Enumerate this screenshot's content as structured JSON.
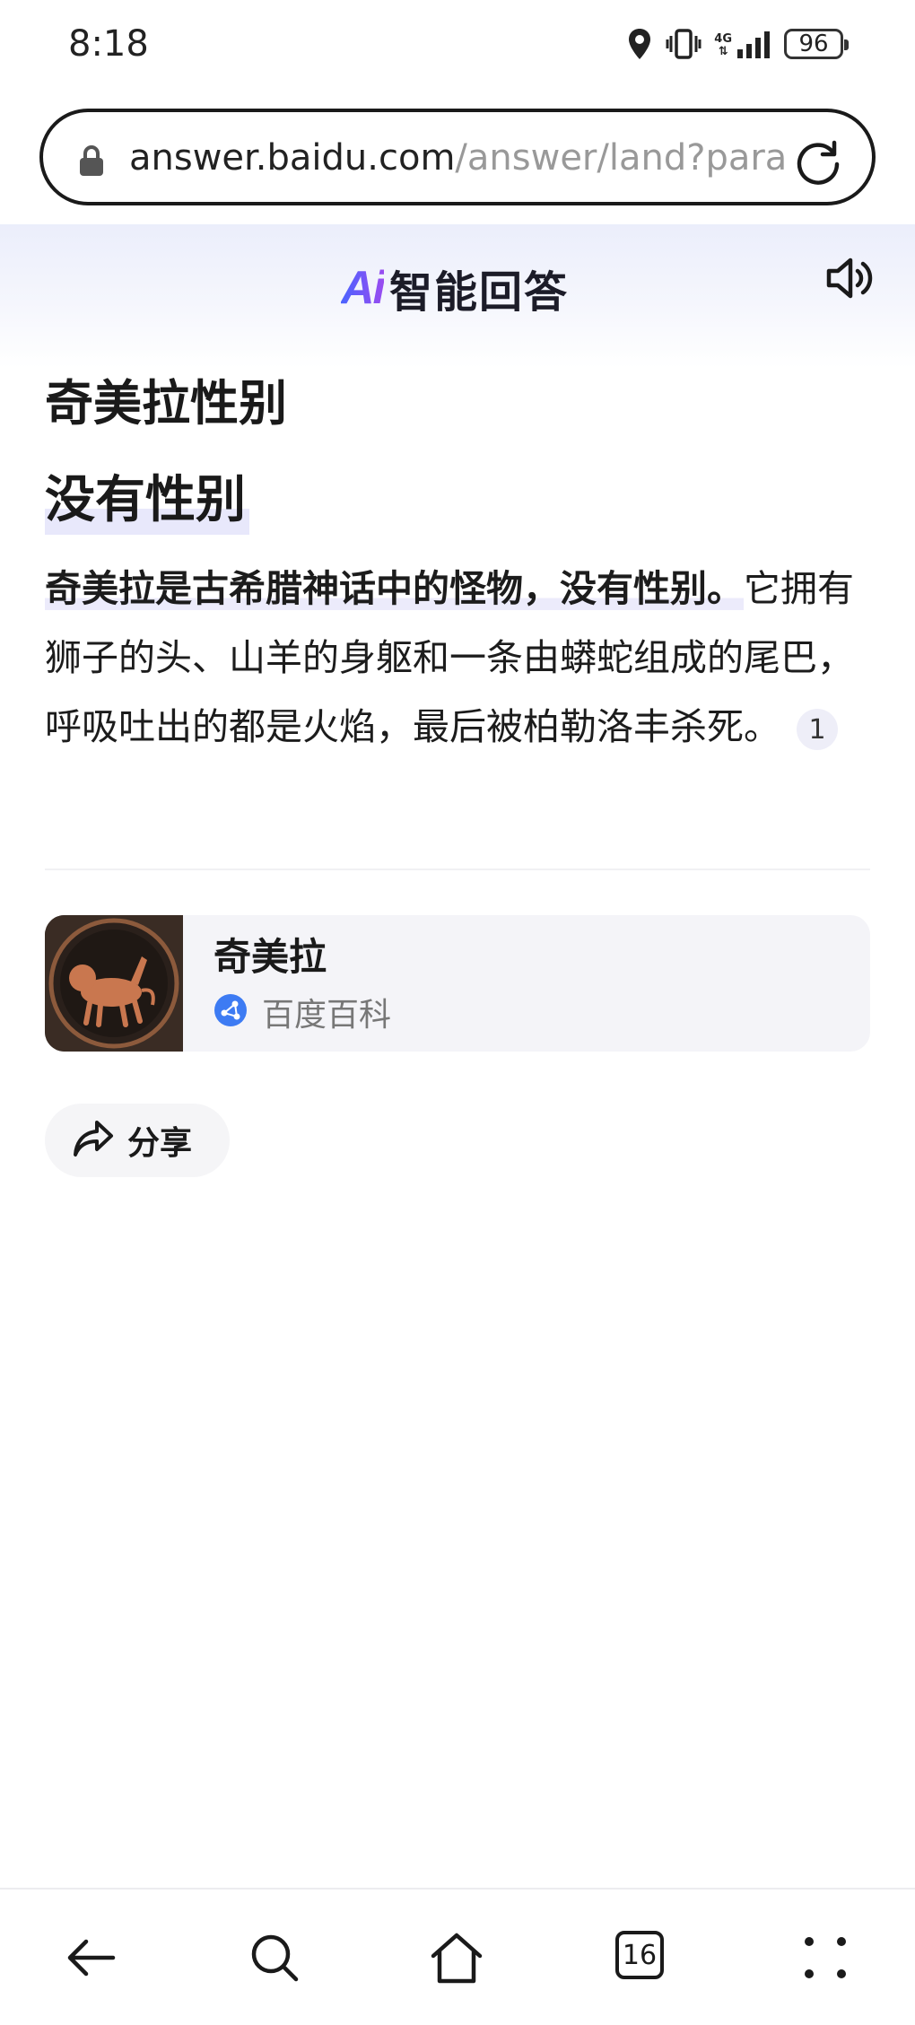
{
  "status_bar": {
    "time": "8:18",
    "network": "4G",
    "battery": "96",
    "icons": [
      "location-icon",
      "vibrate-icon",
      "signal-icon",
      "battery-icon"
    ]
  },
  "url_bar": {
    "host": "answer.baidu.com",
    "path": "/answer/land?para",
    "icons": [
      "lock-icon",
      "reload-icon"
    ]
  },
  "header": {
    "brand_ai": "Ai",
    "brand_name": "智能回答",
    "speaker_icon": "speaker-icon"
  },
  "question": "奇美拉性别",
  "answer": {
    "title": "没有性别",
    "bold_text": "奇美拉是古希腊神话中的怪物，没有性别。",
    "body_text": "它拥有狮子的头、山羊的身躯和一条由蟒蛇组成的尾巴，呼吸吐出的都是火焰，最后被柏勒洛丰杀死。",
    "citation": "1"
  },
  "source": {
    "title": "奇美拉",
    "site": "百度百科"
  },
  "share": {
    "label": "分享"
  },
  "bottom_nav": {
    "tab_count": "16",
    "icons": [
      "back-arrow-icon",
      "search-icon",
      "home-icon",
      "tabs-icon",
      "menu-dots-icon"
    ]
  },
  "colors": {
    "brand_gradient_start": "#4a63ff",
    "brand_gradient_end": "#9a4cf0",
    "baike_blue": "#3d7bf3",
    "card_bg": "#f4f4f8"
  }
}
